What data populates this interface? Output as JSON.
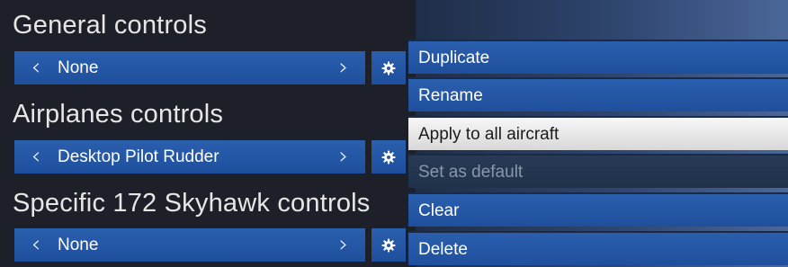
{
  "sections": [
    {
      "title": "General controls",
      "value": "None"
    },
    {
      "title": "Airplanes controls",
      "value": "Desktop Pilot Rudder"
    },
    {
      "title": "Specific 172 Skyhawk controls",
      "value": "None"
    }
  ],
  "icons": {
    "prev": "chevron-left-icon",
    "next": "chevron-right-icon",
    "settings": "gear-icon"
  },
  "menu": {
    "items": [
      {
        "label": "Duplicate",
        "state": "normal"
      },
      {
        "label": "Rename",
        "state": "normal"
      },
      {
        "label": "Apply to all aircraft",
        "state": "hover"
      },
      {
        "label": "Set as default",
        "state": "disabled"
      },
      {
        "label": "Clear",
        "state": "normal"
      },
      {
        "label": "Delete",
        "state": "normal"
      }
    ]
  },
  "colors": {
    "accent": "#2659a8",
    "highlight": "#e9e9e9",
    "disabled_text": "#8b97a8"
  }
}
